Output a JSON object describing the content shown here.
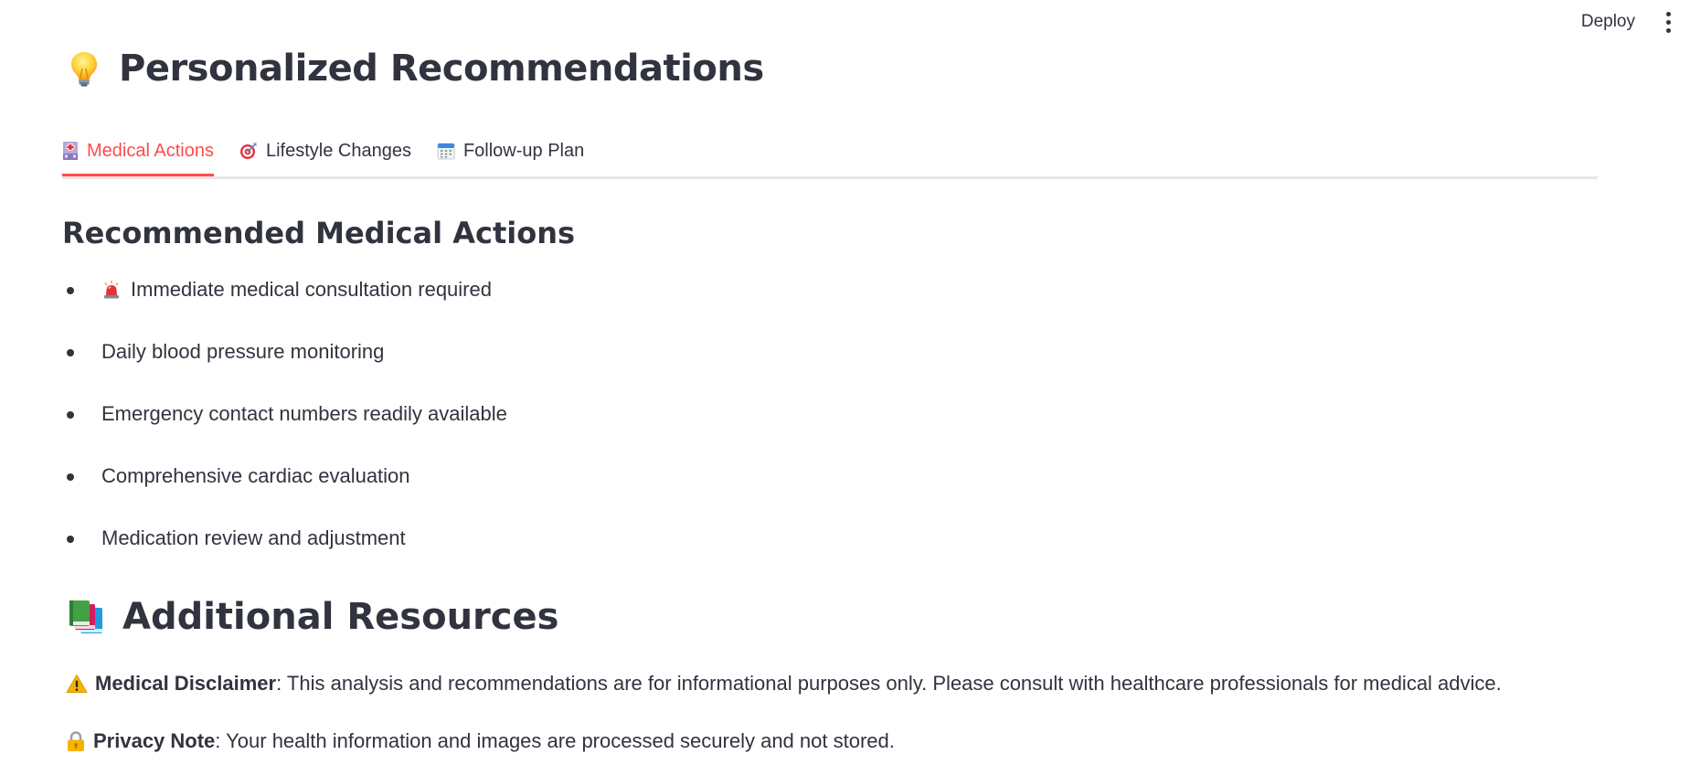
{
  "toolbar": {
    "deploy_label": "Deploy",
    "menu_icon": "kebab-menu-icon"
  },
  "page": {
    "title": "Personalized Recommendations",
    "title_icon": "lightbulb-icon"
  },
  "tabs": [
    {
      "label": "Medical Actions",
      "icon": "hospital-icon",
      "active": true
    },
    {
      "label": "Lifestyle Changes",
      "icon": "target-icon",
      "active": false
    },
    {
      "label": "Follow-up Plan",
      "icon": "calendar-icon",
      "active": false
    }
  ],
  "medical_actions": {
    "heading": "Recommended Medical Actions",
    "items": [
      {
        "text": "Immediate medical consultation required",
        "icon": "siren-icon"
      },
      {
        "text": "Daily blood pressure monitoring"
      },
      {
        "text": "Emergency contact numbers readily available"
      },
      {
        "text": "Comprehensive cardiac evaluation"
      },
      {
        "text": "Medication review and adjustment"
      }
    ]
  },
  "resources": {
    "heading": "Additional Resources",
    "heading_icon": "books-icon",
    "disclaimer": {
      "icon": "warning-icon",
      "label": "Medical Disclaimer",
      "text": ": This analysis and recommendations are for informational purposes only. Please consult with healthcare professionals for medical advice."
    },
    "privacy": {
      "icon": "lock-icon",
      "label": "Privacy Note",
      "text": ": Your health information and images are processed securely and not stored."
    }
  },
  "colors": {
    "accent": "#ff4b4b",
    "text": "#31333f",
    "tab_border": "#e6e6ea"
  }
}
